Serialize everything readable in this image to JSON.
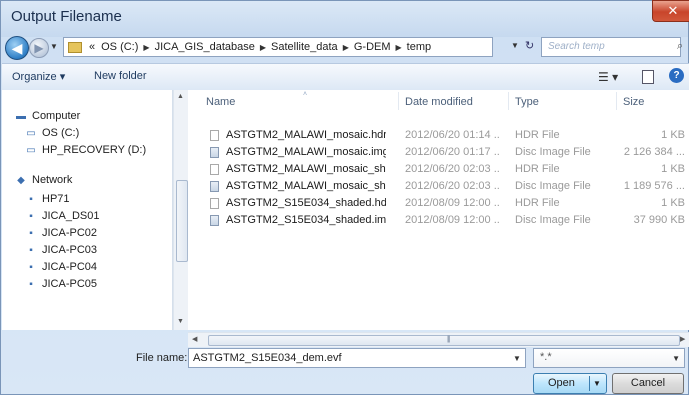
{
  "window": {
    "title": "Output Filename",
    "close": "✕"
  },
  "nav": {
    "back": "◀",
    "forward": "▶",
    "recent": "▼",
    "breadcrumbs": [
      "«",
      "OS (C:)",
      "JICA_GIS_database",
      "Satellite_data",
      "G-DEM",
      "temp"
    ],
    "search_placeholder": "Search temp"
  },
  "toolbar": {
    "organize": "Organize ▾",
    "new_folder": "New folder",
    "views": "☰ ▾",
    "help": "?"
  },
  "sidebar": {
    "items": [
      {
        "label": "Computer",
        "icon": "computer-icon",
        "glyph": "▬"
      },
      {
        "label": "OS (C:)",
        "icon": "drive-icon",
        "glyph": "▭"
      },
      {
        "label": "HP_RECOVERY (D:)",
        "icon": "drive-icon",
        "glyph": "▭"
      },
      {
        "label": "Network",
        "icon": "network-icon",
        "glyph": "◆"
      },
      {
        "label": "HP71",
        "icon": "computer-icon",
        "glyph": "▪"
      },
      {
        "label": "JICA_DS01",
        "icon": "computer-icon",
        "glyph": "▪"
      },
      {
        "label": "JICA-PC02",
        "icon": "computer-icon",
        "glyph": "▪"
      },
      {
        "label": "JICA-PC03",
        "icon": "computer-icon",
        "glyph": "▪"
      },
      {
        "label": "JICA-PC04",
        "icon": "computer-icon",
        "glyph": "▪"
      },
      {
        "label": "JICA-PC05",
        "icon": "computer-icon",
        "glyph": "▪"
      }
    ]
  },
  "columns": {
    "name": "Name",
    "date": "Date modified",
    "type": "Type",
    "size": "Size"
  },
  "files": [
    {
      "name": "ASTGTM2_MALAWI_mosaic.hdr",
      "date": "2012/06/20 01:14 ...",
      "type": "HDR File",
      "size": "1 KB",
      "kind": "doc"
    },
    {
      "name": "ASTGTM2_MALAWI_mosaic.img",
      "date": "2012/06/20 01:17 ...",
      "type": "Disc Image File",
      "size": "2 126 384 ...",
      "kind": "img"
    },
    {
      "name": "ASTGTM2_MALAWI_mosaic_shade...",
      "date": "2012/06/20 02:03 ...",
      "type": "HDR File",
      "size": "1 KB",
      "kind": "doc"
    },
    {
      "name": "ASTGTM2_MALAWI_mosaic_shade...",
      "date": "2012/06/20 02:03 ...",
      "type": "Disc Image File",
      "size": "1 189 576 ...",
      "kind": "img"
    },
    {
      "name": "ASTGTM2_S15E034_shaded.hdr",
      "date": "2012/08/09 12:00 ...",
      "type": "HDR File",
      "size": "1 KB",
      "kind": "doc"
    },
    {
      "name": "ASTGTM2_S15E034_shaded.img",
      "date": "2012/08/09 12:00 ...",
      "type": "Disc Image File",
      "size": "37 990 KB",
      "kind": "img"
    }
  ],
  "footer": {
    "filename_label": "File name:",
    "filename_value": "ASTGTM2_S15E034_dem.evf",
    "filter_value": "*.*",
    "open": "Open",
    "cancel": "Cancel"
  }
}
